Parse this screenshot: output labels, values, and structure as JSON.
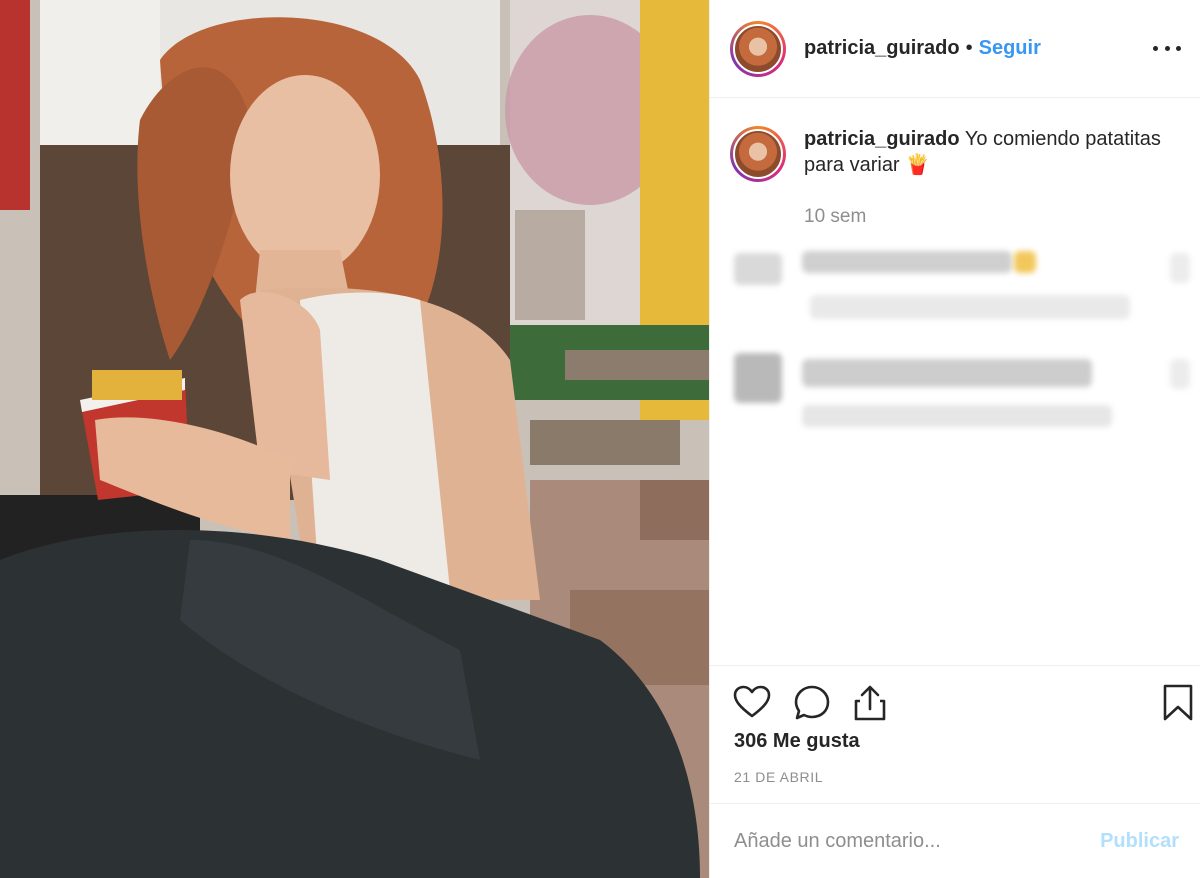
{
  "post": {
    "username": "patricia_guirado",
    "separator": "•",
    "follow_label": "Seguir",
    "caption": "Yo comiendo patatitas para variar 🍟",
    "time_ago": "10 sem",
    "likes": "306 Me gusta",
    "date": "21 DE ABRIL",
    "comment_placeholder": "Añade un comentario...",
    "publish_label": "Publicar"
  },
  "icons": [
    "heart-icon",
    "comment-icon",
    "share-icon",
    "bookmark-icon",
    "more-options-icon"
  ],
  "colors": {
    "link_blue": "#3897f0",
    "publish_disabled": "#b2dffc",
    "secondary_text": "#8e8e8e",
    "primary_text": "#262626",
    "divider": "#efefef"
  }
}
